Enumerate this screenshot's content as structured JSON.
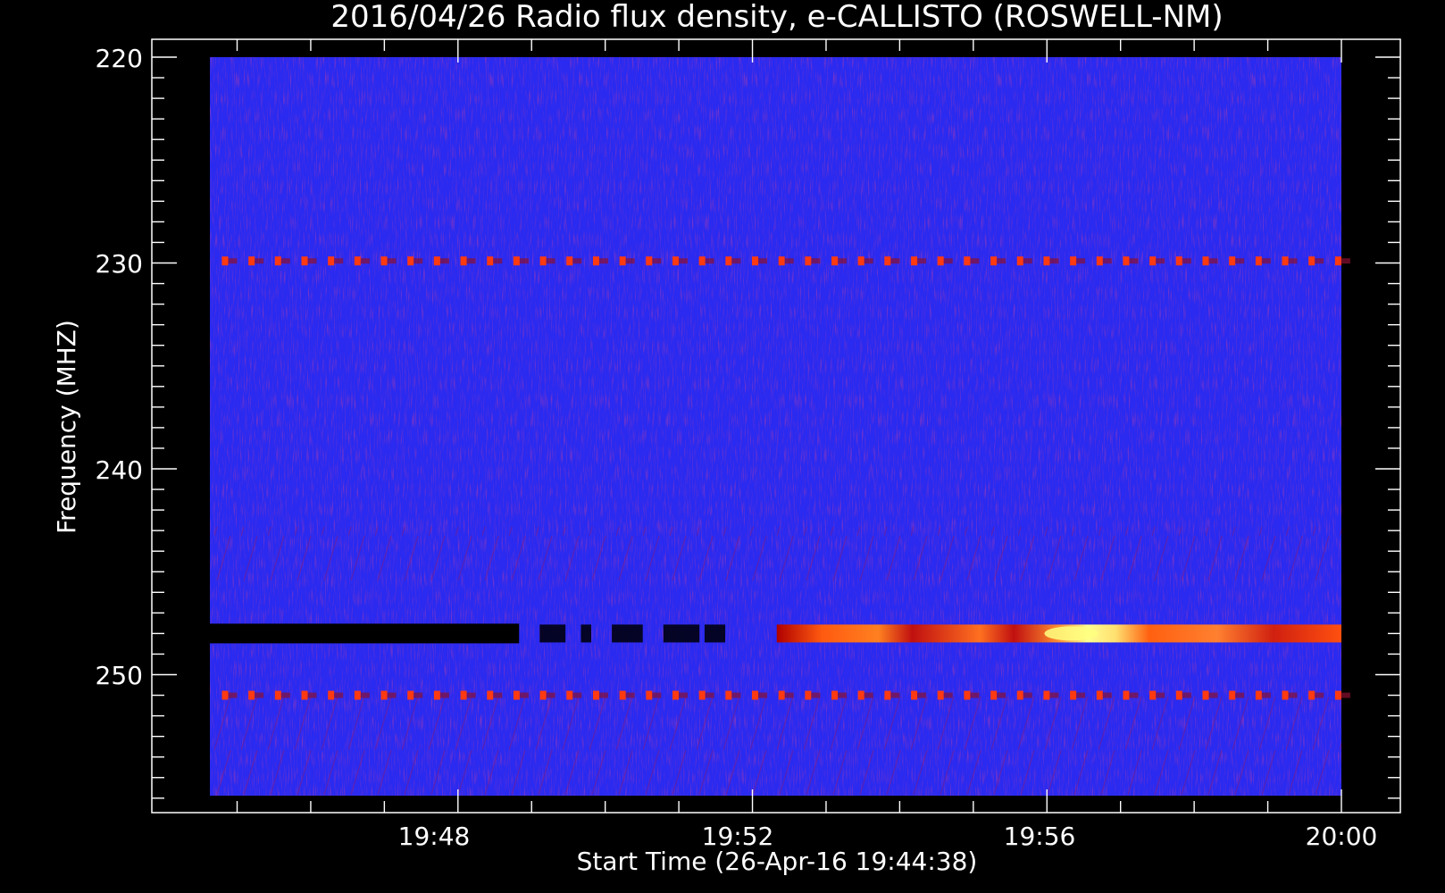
{
  "chart_data": {
    "type": "heatmap",
    "title": "2016/04/26  Radio flux density, e-CALLISTO (ROSWELL-NM)",
    "xlabel": "Start Time (26-Apr-16 19:44:38)",
    "ylabel": "Frequency (MHZ)",
    "x_ticks": [
      "19:48",
      "19:52",
      "19:56",
      "20:00"
    ],
    "y_ticks": [
      "220",
      "230",
      "240",
      "250"
    ],
    "x_range_minutes": [
      0,
      15.37
    ],
    "y_range_mhz": [
      219.1,
      256.0
    ],
    "y_reversed": true,
    "features": [
      {
        "name": "periodic interference line",
        "freq_mhz": 229.9,
        "period_min": 0.36
      },
      {
        "name": "periodic interference line",
        "freq_mhz": 251.0,
        "period_min": 0.36
      },
      {
        "name": "absorption band",
        "freq_mhz": 248.0,
        "start_min": 0.0,
        "end_min": 7.0
      },
      {
        "name": "emission band",
        "freq_mhz": 248.0,
        "start_min": 7.7,
        "end_min": 15.37,
        "peak_min": 11.7
      }
    ],
    "colors": {
      "background": "#2828f0",
      "absorption": "#000000",
      "emission_low": "#c00000",
      "emission_mid": "#ff5000",
      "emission_peak": "#ffff80"
    },
    "grid": false
  }
}
